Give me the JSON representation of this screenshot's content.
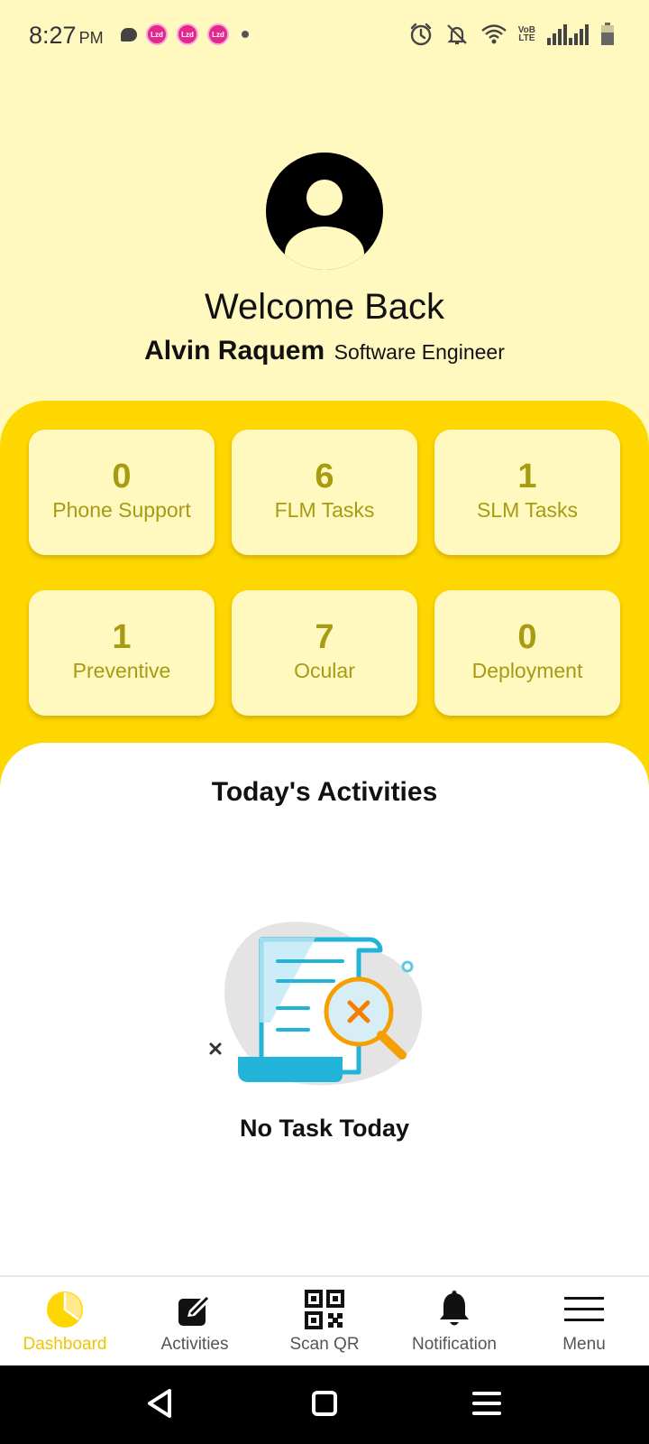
{
  "status_bar": {
    "time": "8:27",
    "ampm": "PM",
    "app_badge_text": "Lzd",
    "network_label_top": "VoB",
    "network_label_bottom": "LTE",
    "icons": [
      "message-icon",
      "lazada-icon",
      "lazada-icon",
      "lazada-icon",
      "dot-icon",
      "alarm-icon",
      "bell-off-icon",
      "wifi-icon",
      "volte-icon",
      "signal-icon",
      "signal-icon",
      "battery-icon"
    ]
  },
  "profile": {
    "welcome": "Welcome Back",
    "name": "Alvin Raquem",
    "role": "Software Engineer"
  },
  "stats": [
    {
      "value": "0",
      "label": "Phone Support"
    },
    {
      "value": "6",
      "label": "FLM Tasks"
    },
    {
      "value": "1",
      "label": "SLM Tasks"
    },
    {
      "value": "1",
      "label": "Preventive"
    },
    {
      "value": "7",
      "label": "Ocular"
    },
    {
      "value": "0",
      "label": "Deployment"
    }
  ],
  "activities": {
    "title": "Today's Activities",
    "empty_text": "No Task Today"
  },
  "bottom_nav": [
    {
      "label": "Dashboard",
      "icon": "pie-chart-icon",
      "active": true
    },
    {
      "label": "Activities",
      "icon": "edit-icon",
      "active": false
    },
    {
      "label": "Scan QR",
      "icon": "qr-code-icon",
      "active": false
    },
    {
      "label": "Notification",
      "icon": "bell-icon",
      "active": false
    },
    {
      "label": "Menu",
      "icon": "menu-icon",
      "active": false
    }
  ],
  "colors": {
    "background": "#FFF9C0",
    "panel": "#FFD700",
    "stat_text": "#A79B12",
    "active_nav": "#F2C300"
  }
}
